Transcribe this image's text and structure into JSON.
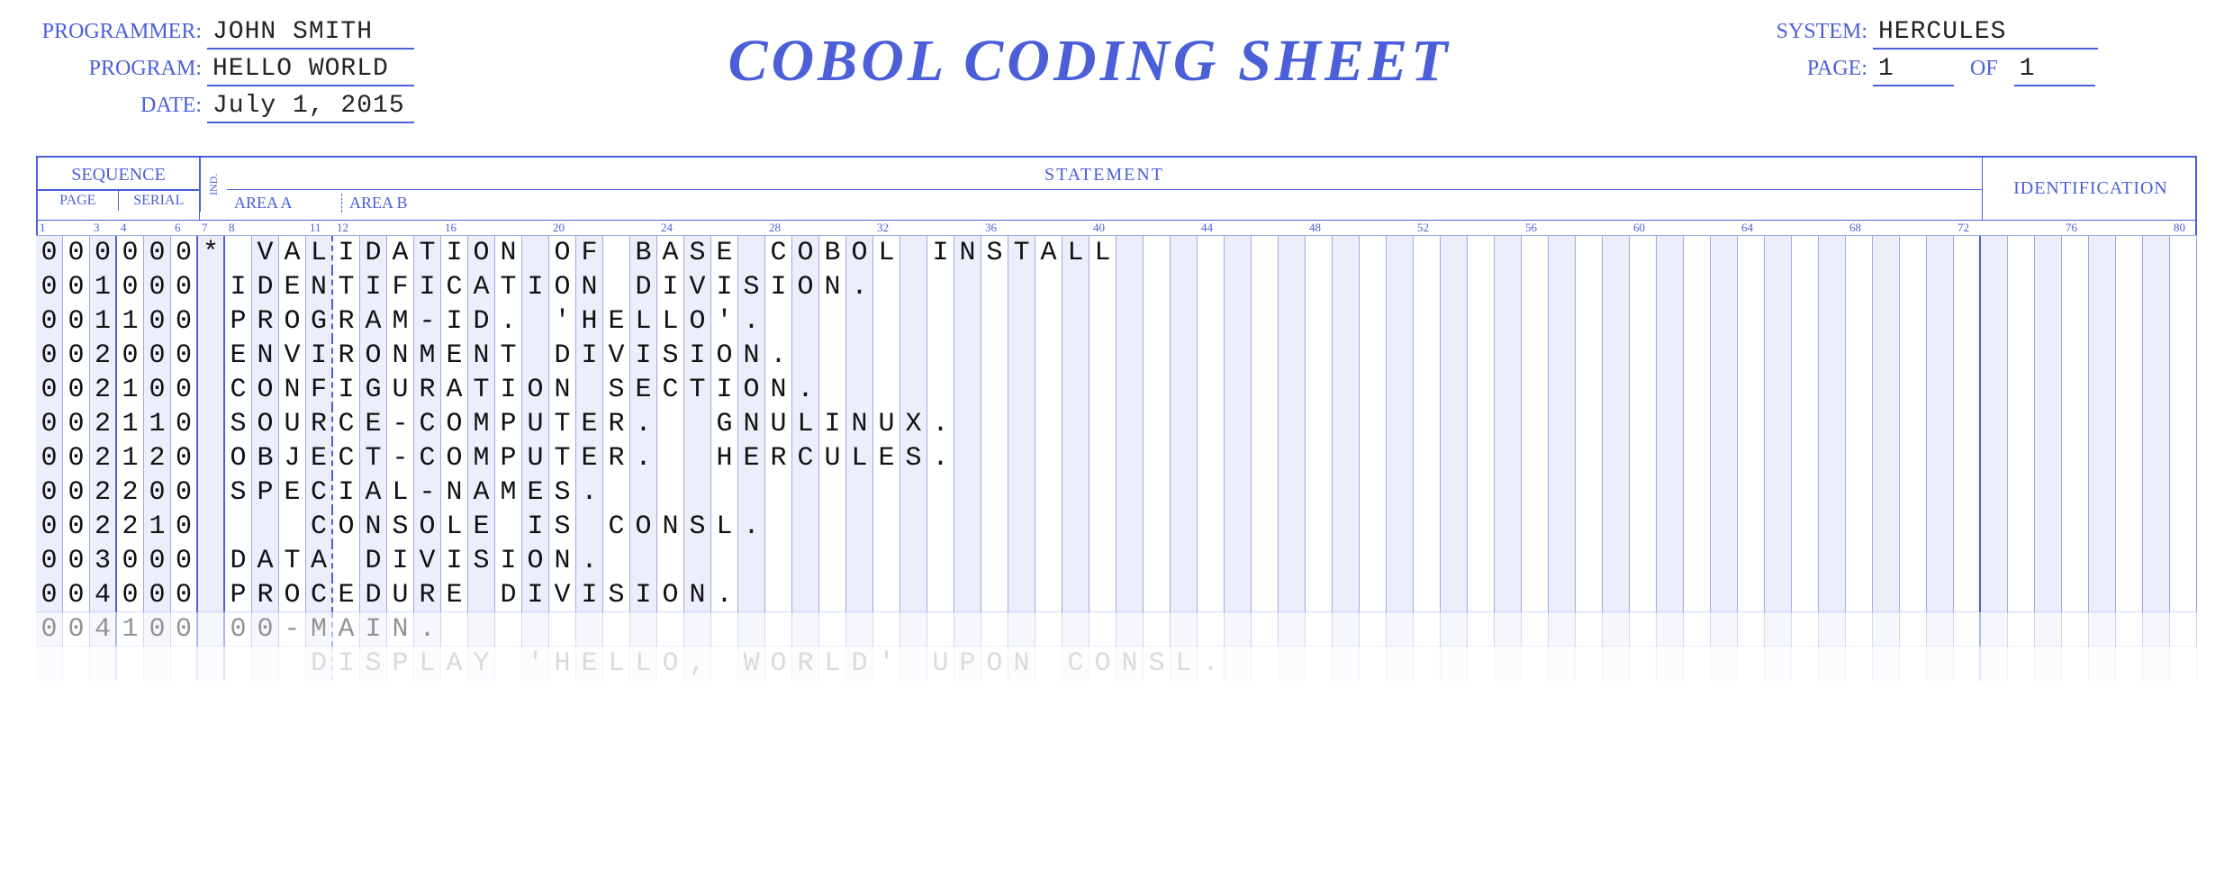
{
  "header": {
    "programmer_label": "PROGRAMMER:",
    "programmer": "JOHN SMITH",
    "program_label": "PROGRAM:",
    "program": "HELLO WORLD",
    "date_label": "DATE:",
    "date": "July 1, 2015",
    "title": "COBOL CODING SHEET",
    "system_label": "SYSTEM:",
    "system": "HERCULES",
    "page_label": "PAGE:",
    "page": "1",
    "of_label": "OF",
    "of": "1"
  },
  "columns": {
    "sequence": "SEQUENCE",
    "page": "PAGE",
    "serial": "SERIAL",
    "ind": "IND.",
    "statement": "STATEMENT",
    "area_a": "AREA A",
    "area_b": "AREA B",
    "identification": "IDENTIFICATION",
    "ruler_marks": {
      "1": "1",
      "3": "3",
      "4": "4",
      "6": "6",
      "7": "7",
      "8": "8",
      "11": "11",
      "12": "12",
      "16": "16",
      "20": "20",
      "24": "24",
      "28": "28",
      "32": "32",
      "36": "36",
      "40": "40",
      "44": "44",
      "48": "48",
      "52": "52",
      "56": "56",
      "60": "60",
      "64": "64",
      "68": "68",
      "72": "72",
      "76": "76",
      "80": "80"
    }
  },
  "code_rows": [
    {
      "seq": "000000",
      "ind": "*",
      "text": " VALIDATION OF BASE COBOL INSTALL",
      "ident": ""
    },
    {
      "seq": "001000",
      "ind": " ",
      "text": "IDENTIFICATION DIVISION.",
      "ident": ""
    },
    {
      "seq": "001100",
      "ind": " ",
      "text": "PROGRAM-ID. 'HELLO'.",
      "ident": ""
    },
    {
      "seq": "002000",
      "ind": " ",
      "text": "ENVIRONMENT DIVISION.",
      "ident": ""
    },
    {
      "seq": "002100",
      "ind": " ",
      "text": "CONFIGURATION SECTION.",
      "ident": ""
    },
    {
      "seq": "002110",
      "ind": " ",
      "text": "SOURCE-COMPUTER.  GNULINUX.",
      "ident": ""
    },
    {
      "seq": "002120",
      "ind": " ",
      "text": "OBJECT-COMPUTER.  HERCULES.",
      "ident": ""
    },
    {
      "seq": "002200",
      "ind": " ",
      "text": "SPECIAL-NAMES.",
      "ident": ""
    },
    {
      "seq": "002210",
      "ind": " ",
      "text": "   CONSOLE IS CONSL.",
      "ident": ""
    },
    {
      "seq": "003000",
      "ind": " ",
      "text": "DATA DIVISION.",
      "ident": ""
    },
    {
      "seq": "004000",
      "ind": " ",
      "text": "PROCEDURE DIVISION.",
      "ident": ""
    },
    {
      "seq": "004100",
      "ind": " ",
      "text": "00-MAIN.",
      "ident": "",
      "fade": 1
    },
    {
      "seq": "      ",
      "ind": " ",
      "text": "   DISPLAY 'HELLO, WORLD' UPON CONSL.",
      "ident": "",
      "fade": 2
    }
  ]
}
